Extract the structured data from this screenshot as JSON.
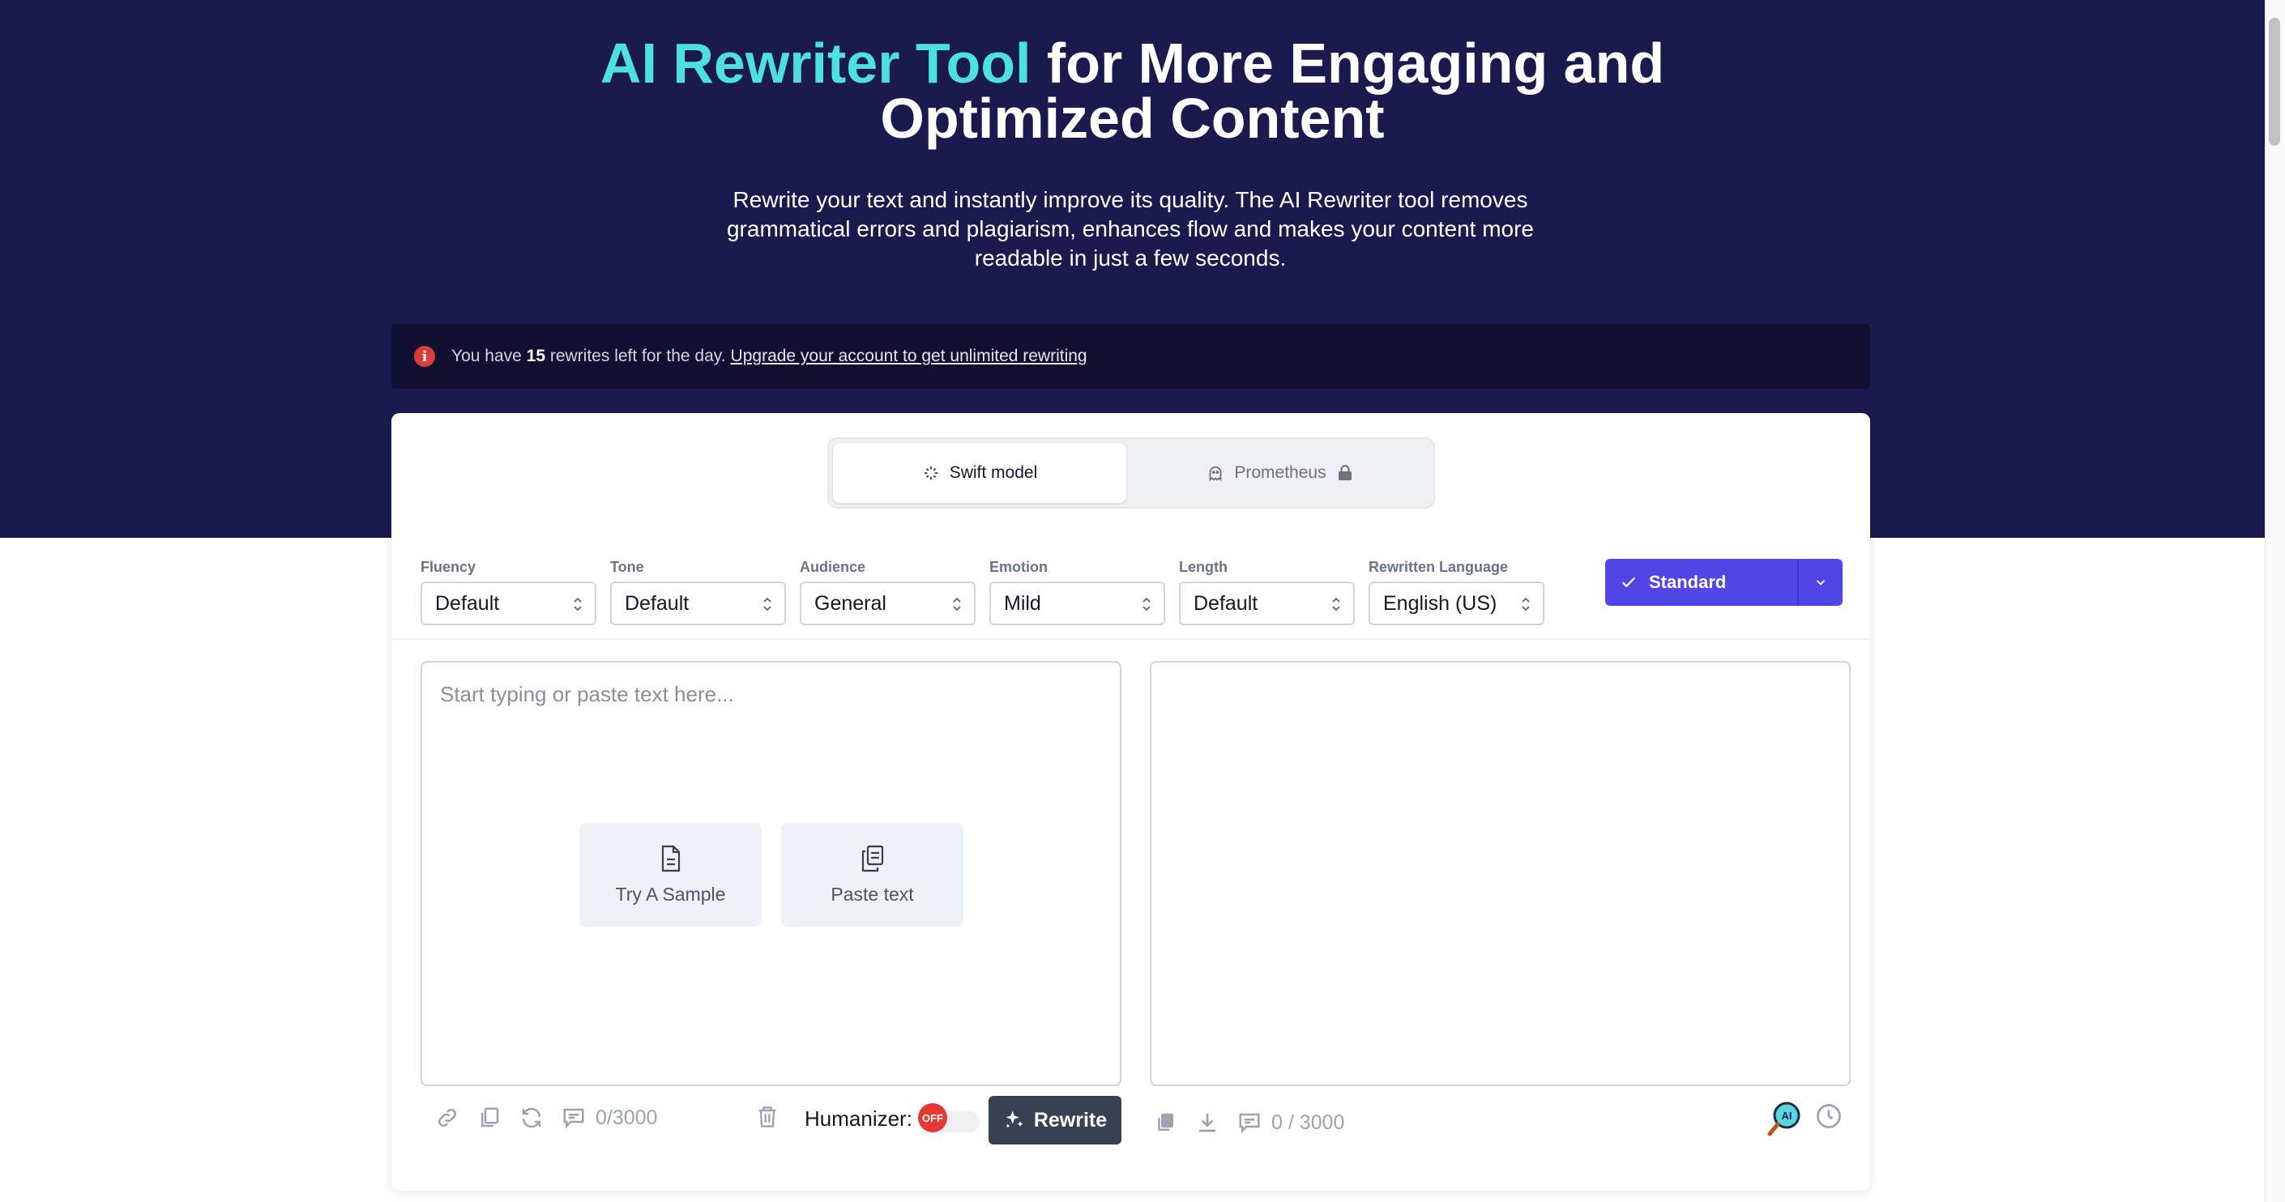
{
  "hero": {
    "title_accent": "AI Rewriter Tool",
    "title_rest_line1": " for More Engaging and",
    "title_line2": "Optimized Content",
    "subtitle": "Rewrite your text and instantly improve its quality. The AI Rewriter tool removes grammatical errors and plagiarism, enhances flow and makes your content more readable in just a few seconds."
  },
  "notice": {
    "prefix": "You have ",
    "count": "15",
    "suffix": " rewrites left for the day.",
    "link": "Upgrade your account to get unlimited rewriting"
  },
  "models": {
    "active": "Swift model",
    "locked": "Prometheus"
  },
  "controls": [
    {
      "label": "Fluency",
      "value": "Default"
    },
    {
      "label": "Tone",
      "value": "Default"
    },
    {
      "label": "Audience",
      "value": "General"
    },
    {
      "label": "Emotion",
      "value": "Mild"
    },
    {
      "label": "Length",
      "value": "Default"
    },
    {
      "label": "Rewritten Language",
      "value": "English (US)"
    }
  ],
  "mode": {
    "label": "Standard"
  },
  "input": {
    "placeholder": "Start typing or paste text here...",
    "sample_label": "Try A Sample",
    "paste_label": "Paste text",
    "counter": "0/3000"
  },
  "humanizer": {
    "label": "Humanizer:",
    "state": "OFF"
  },
  "rewrite_label": "Rewrite",
  "output": {
    "counter": "0 / 3000"
  },
  "colors": {
    "hero_bg": "#1b1a4f",
    "accent": "#4de0e0",
    "primary": "#4f46e5",
    "rewrite_btn": "#374151",
    "toggle_off": "#e53935"
  }
}
